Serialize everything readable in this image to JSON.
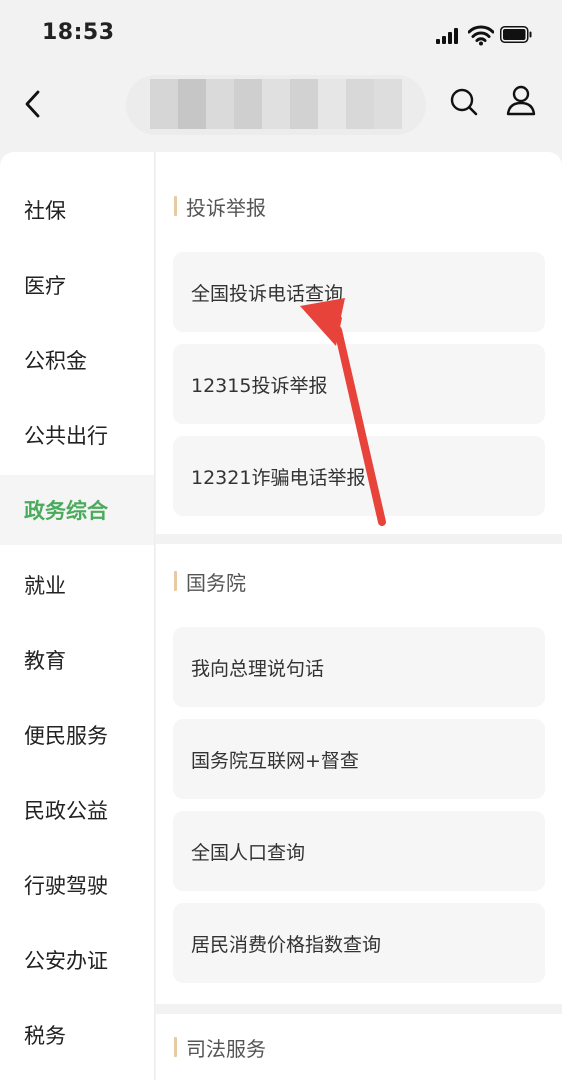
{
  "status_bar": {
    "time": "18:53"
  },
  "nav": {
    "back_icon": "chevron-left-icon",
    "search_icon": "search-icon",
    "user_icon": "user-icon"
  },
  "sidebar": {
    "items": [
      {
        "label": "社保",
        "active": false
      },
      {
        "label": "医疗",
        "active": false
      },
      {
        "label": "公积金",
        "active": false
      },
      {
        "label": "公共出行",
        "active": false
      },
      {
        "label": "政务综合",
        "active": true
      },
      {
        "label": "就业",
        "active": false
      },
      {
        "label": "教育",
        "active": false
      },
      {
        "label": "便民服务",
        "active": false
      },
      {
        "label": "民政公益",
        "active": false
      },
      {
        "label": "行驶驾驶",
        "active": false
      },
      {
        "label": "公安办证",
        "active": false
      },
      {
        "label": "税务",
        "active": false
      }
    ]
  },
  "sections": [
    {
      "title": "投诉举报",
      "items": [
        "全国投诉电话查询",
        "12315投诉举报",
        "12321诈骗电话举报"
      ]
    },
    {
      "title": "国务院",
      "items": [
        "我向总理说句话",
        "国务院互联网+督查",
        "全国人口查询",
        "居民消费价格指数查询"
      ]
    },
    {
      "title": "司法服务",
      "items": []
    }
  ],
  "colors": {
    "accent": "#4aab5c",
    "annotation_arrow": "#e8433a",
    "section_bar": "#e7c9a6"
  }
}
